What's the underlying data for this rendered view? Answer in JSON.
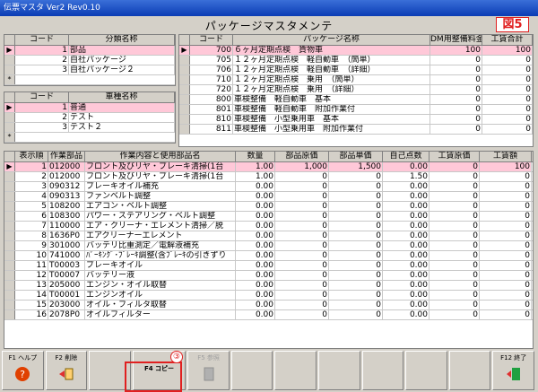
{
  "window_title": "伝票マスタ Ver2 Rev0.10",
  "main_title": "パッケージマスタメンテ",
  "figure_label": "図5",
  "bunrui": {
    "headers": [
      "コード",
      "分類名称"
    ],
    "rows": [
      {
        "code": "1",
        "name": "部品",
        "selected": true
      },
      {
        "code": "2",
        "name": "自社パッケージ"
      },
      {
        "code": "3",
        "name": "自社パッケージ２"
      }
    ]
  },
  "shashu": {
    "headers": [
      "コード",
      "車種名称"
    ],
    "rows": [
      {
        "code": "1",
        "name": "普通",
        "selected": true
      },
      {
        "code": "2",
        "name": "テスト"
      },
      {
        "code": "3",
        "name": "テスト２"
      }
    ]
  },
  "package": {
    "headers": [
      "コード",
      "パッケージ名称",
      "DM用整備料金",
      "工賃合計"
    ],
    "rows": [
      {
        "code": "700",
        "name": "６ヶ月定期点検　貨物車",
        "dm": "100",
        "total": "100",
        "selected": true
      },
      {
        "code": "705",
        "name": "１２ヶ月定期点検　軽自動車　（簡単）",
        "dm": "0",
        "total": "0"
      },
      {
        "code": "706",
        "name": "１２ヶ月定期点検　軽自動車　（詳細）",
        "dm": "0",
        "total": "0"
      },
      {
        "code": "710",
        "name": "１２ヶ月定期点検　乗用　（簡単）",
        "dm": "0",
        "total": "0"
      },
      {
        "code": "720",
        "name": "１２ヶ月定期点検　乗用　（詳細）",
        "dm": "0",
        "total": "0"
      },
      {
        "code": "800",
        "name": "車検整備　軽自動車　基本",
        "dm": "0",
        "total": "0"
      },
      {
        "code": "801",
        "name": "車検整備　軽自動車　附加作業付",
        "dm": "0",
        "total": "0"
      },
      {
        "code": "810",
        "name": "車検整備　小型乗用車　基本",
        "dm": "0",
        "total": "0"
      },
      {
        "code": "811",
        "name": "車検整備　小型乗用車　附加作業付",
        "dm": "0",
        "total": "0"
      }
    ]
  },
  "detail": {
    "headers": [
      "表示順",
      "作業部品",
      "作業内容と使用部品名",
      "数量",
      "部品原価",
      "部品単価",
      "自己点数",
      "工賃原価",
      "工賃額"
    ],
    "rows": [
      {
        "no": "1",
        "part": "012000",
        "desc": "フロント及びリヤ・ブレーキ清掃(1台",
        "qty": "1.00",
        "cost": "1,000",
        "price": "1,500",
        "pts": "0.00",
        "lcost": "0",
        "lamt": "100",
        "selected": true
      },
      {
        "no": "2",
        "part": "012000",
        "desc": "フロント及びリヤ・ブレーキ清掃(1台",
        "qty": "1.00",
        "cost": "0",
        "price": "0",
        "pts": "1.50",
        "lcost": "0",
        "lamt": "0"
      },
      {
        "no": "3",
        "part": "090312",
        "desc": "ブレーキオイル補充",
        "qty": "0.00",
        "cost": "0",
        "price": "0",
        "pts": "0.00",
        "lcost": "0",
        "lamt": "0"
      },
      {
        "no": "4",
        "part": "090313",
        "desc": "ファンベルト調整",
        "qty": "0.00",
        "cost": "0",
        "price": "0",
        "pts": "0.00",
        "lcost": "0",
        "lamt": "0"
      },
      {
        "no": "5",
        "part": "108200",
        "desc": "エアコン・ベルト調整",
        "qty": "0.00",
        "cost": "0",
        "price": "0",
        "pts": "0.00",
        "lcost": "0",
        "lamt": "0"
      },
      {
        "no": "6",
        "part": "108300",
        "desc": "パワー・ステアリング・ベルト調整",
        "qty": "0.00",
        "cost": "0",
        "price": "0",
        "pts": "0.00",
        "lcost": "0",
        "lamt": "0"
      },
      {
        "no": "7",
        "part": "110000",
        "desc": "エア・クリーナ・エレメント清掃／脱",
        "qty": "0.00",
        "cost": "0",
        "price": "0",
        "pts": "0.00",
        "lcost": "0",
        "lamt": "0"
      },
      {
        "no": "8",
        "part": "1636P0",
        "desc": "エアクリーナーエレメント",
        "qty": "0.00",
        "cost": "0",
        "price": "0",
        "pts": "0.00",
        "lcost": "0",
        "lamt": "0"
      },
      {
        "no": "9",
        "part": "301000",
        "desc": "バッテリ比重測定／電解液補充",
        "qty": "0.00",
        "cost": "0",
        "price": "0",
        "pts": "0.00",
        "lcost": "0",
        "lamt": "0"
      },
      {
        "no": "10",
        "part": "741000",
        "desc": "ﾊﾟｰｷﾝｸﾞ･ﾌﾞﾚｰｷ調整(含ﾌﾞﾚｰｷの引きずり",
        "qty": "0.00",
        "cost": "0",
        "price": "0",
        "pts": "0.00",
        "lcost": "0",
        "lamt": "0"
      },
      {
        "no": "11",
        "part": "T00003",
        "desc": "ブレーキオイル",
        "qty": "0.00",
        "cost": "0",
        "price": "0",
        "pts": "0.00",
        "lcost": "0",
        "lamt": "0"
      },
      {
        "no": "12",
        "part": "T00007",
        "desc": "バッテリー液",
        "qty": "0.00",
        "cost": "0",
        "price": "0",
        "pts": "0.00",
        "lcost": "0",
        "lamt": "0"
      },
      {
        "no": "13",
        "part": "205000",
        "desc": "エンジン・オイル取替",
        "qty": "0.00",
        "cost": "0",
        "price": "0",
        "pts": "0.00",
        "lcost": "0",
        "lamt": "0"
      },
      {
        "no": "14",
        "part": "T00001",
        "desc": "エンジンオイル",
        "qty": "0.00",
        "cost": "0",
        "price": "0",
        "pts": "0.00",
        "lcost": "0",
        "lamt": "0"
      },
      {
        "no": "15",
        "part": "203000",
        "desc": "オイル・フィルタ取替",
        "qty": "0.00",
        "cost": "0",
        "price": "0",
        "pts": "0.00",
        "lcost": "0",
        "lamt": "0"
      },
      {
        "no": "16",
        "part": "2078P0",
        "desc": "オイルフィルター",
        "qty": "0.00",
        "cost": "0",
        "price": "0",
        "pts": "0.00",
        "lcost": "0",
        "lamt": "0"
      }
    ]
  },
  "toolbar": {
    "f1": "F1 ヘルプ",
    "f2": "F2 削除",
    "f4": "F4 コピー",
    "f5": "F5 参照",
    "f12": "F12 終了",
    "callout": "③"
  }
}
